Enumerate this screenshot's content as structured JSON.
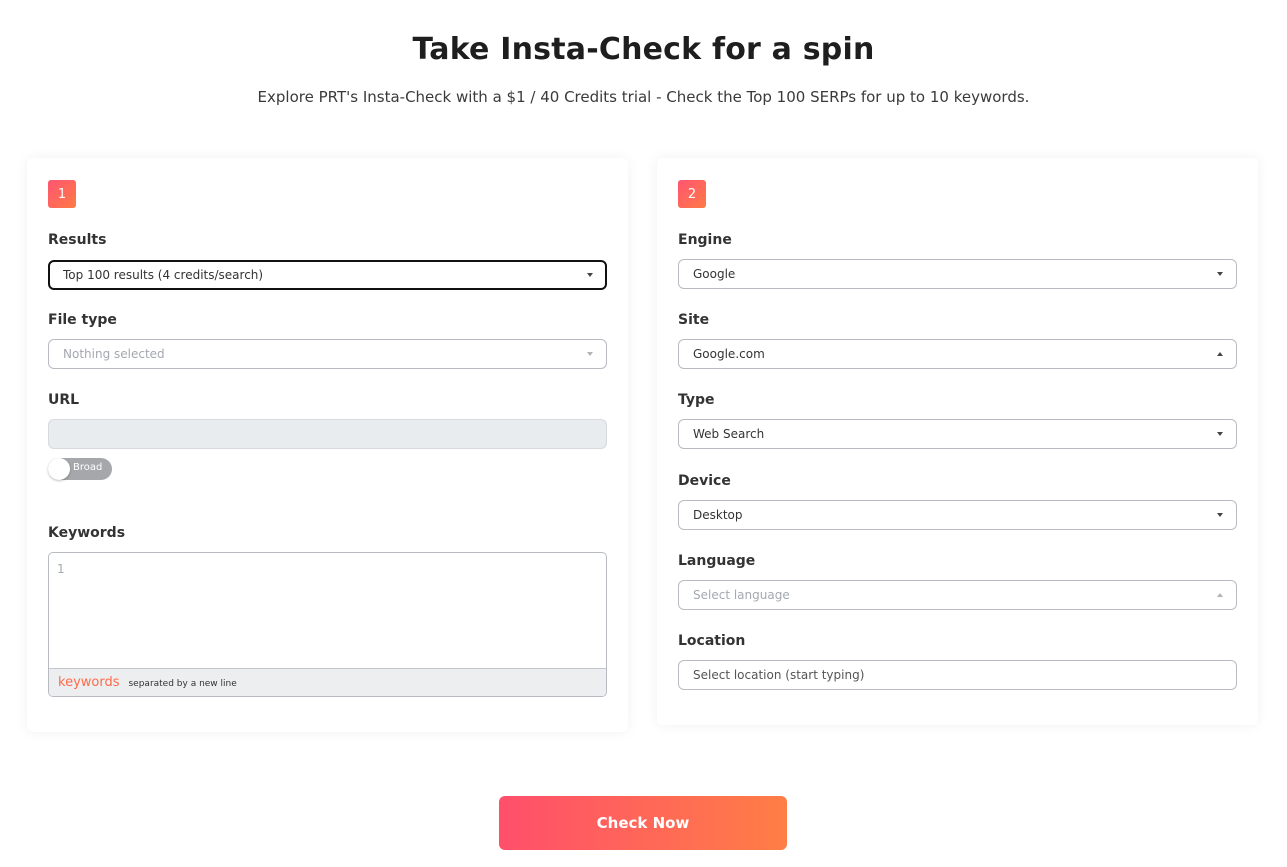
{
  "header": {
    "title": "Take Insta-Check for a spin",
    "subtitle": "Explore PRT's Insta-Check with a $1 / 40 Credits trial - Check the Top 100 SERPs for up to 10 keywords."
  },
  "left_card": {
    "step": "1",
    "results": {
      "label": "Results",
      "value": "Top 100 results (4 credits/search)"
    },
    "file_type": {
      "label": "File type",
      "placeholder": "Nothing selected"
    },
    "url": {
      "label": "URL",
      "value": ""
    },
    "match_toggle": {
      "label": "Broad",
      "on": false
    },
    "keywords": {
      "label": "Keywords",
      "line_number": "1",
      "footer_word": "keywords",
      "footer_hint": "separated by a new line"
    }
  },
  "right_card": {
    "step": "2",
    "engine": {
      "label": "Engine",
      "value": "Google"
    },
    "site": {
      "label": "Site",
      "value": "Google.com"
    },
    "type": {
      "label": "Type",
      "value": "Web Search"
    },
    "device": {
      "label": "Device",
      "value": "Desktop"
    },
    "language": {
      "label": "Language",
      "placeholder": "Select language"
    },
    "location": {
      "label": "Location",
      "placeholder": "Select location (start typing)"
    }
  },
  "actions": {
    "check_now": "Check Now"
  },
  "colors": {
    "accent_start": "#ff5571",
    "accent_end": "#ff7a45",
    "keywords_word": "#ff6a4a",
    "toggle_off": "#a5a7ab"
  }
}
